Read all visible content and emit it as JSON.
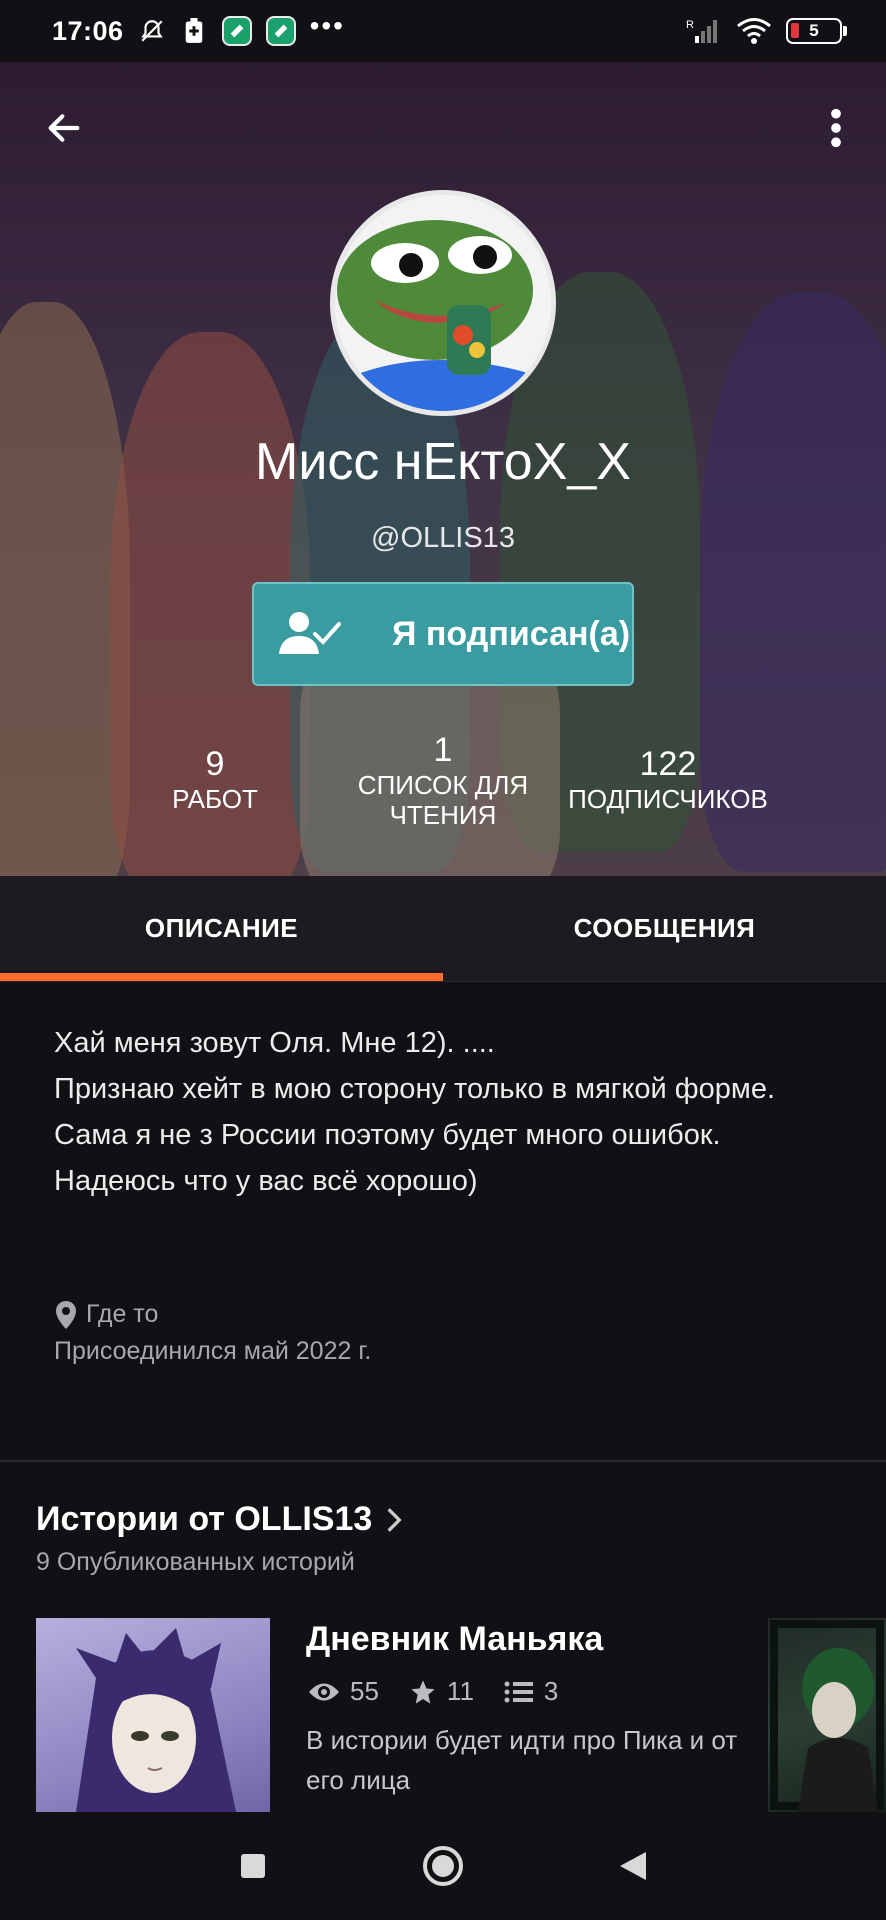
{
  "status_bar": {
    "time": "17:06",
    "battery": "5",
    "network_label": "R",
    "icons": [
      "bell-off-icon",
      "battery-saver-icon",
      "app-icon",
      "app-icon",
      "more-dots-icon",
      "signal-icon",
      "wifi-icon",
      "battery-icon"
    ]
  },
  "profile": {
    "display_name": "Мисс нЕктоX_X",
    "username": "@OLLIS13",
    "follow_label": "Я подписан(а)",
    "stats": [
      {
        "value": "9",
        "label": "РАБОТ"
      },
      {
        "value": "1",
        "label": "СПИСОК ДЛЯ ЧТЕНИЯ"
      },
      {
        "value": "122",
        "label": "ПОДПИСЧИКОВ"
      }
    ]
  },
  "tabs": [
    {
      "label": "ОПИСАНИЕ",
      "active": true
    },
    {
      "label": "СООБЩЕНИЯ",
      "active": false
    }
  ],
  "about": {
    "lines": [
      "Хай меня зовут Оля. Мне 12). ....",
      "Признаю хейт в мою сторону только в мягкой форме.",
      "Сама я не з России поэтому будет много ошибок.",
      "Надеюсь что у вас всё хорошо)"
    ],
    "location": "Где то",
    "joined": "Присоединился май 2022 г."
  },
  "stories_section": {
    "title": "Истории от OLLIS13",
    "subtitle": "9 Опубликованных историй"
  },
  "story": {
    "title": "Дневник Маньяка",
    "views": "55",
    "votes": "11",
    "parts": "3",
    "description": "В истории будет идти про Пика и от его лица"
  },
  "colors": {
    "accent": "#ff6d2e",
    "follow_button": "#3a9ca0",
    "background": "#121014",
    "tab_bar": "#1d1b20"
  }
}
